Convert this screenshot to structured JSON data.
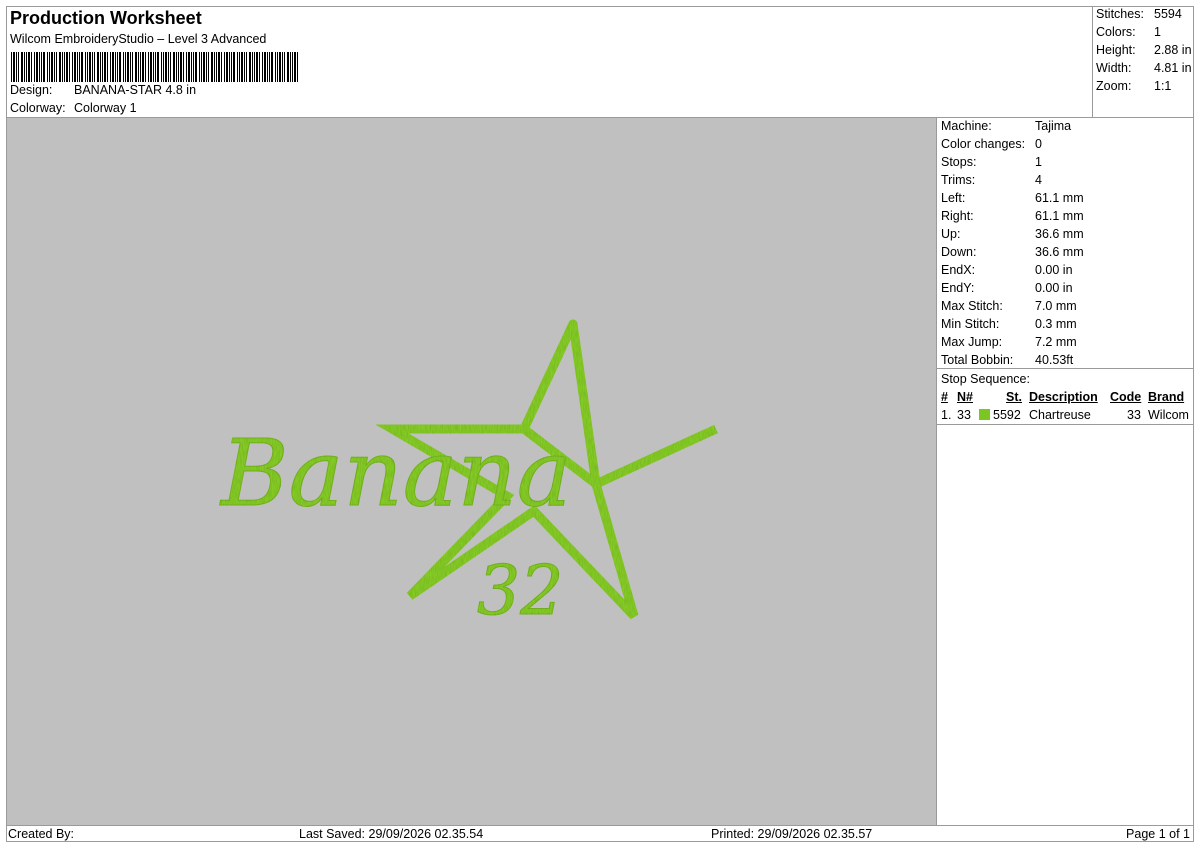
{
  "header": {
    "title": "Production Worksheet",
    "subtitle": "Wilcom EmbroideryStudio – Level 3 Advanced",
    "design_label": "Design:",
    "design_value": "BANANA-STAR 4.8 in",
    "colorway_label": "Colorway:",
    "colorway_value": "Colorway 1"
  },
  "stats": {
    "stitches_label": "Stitches:",
    "stitches": "5594",
    "colors_label": "Colors:",
    "colors": "1",
    "height_label": "Height:",
    "height": "2.88 in",
    "width_label": "Width:",
    "width": "4.81 in",
    "zoom_label": "Zoom:",
    "zoom": "1:1"
  },
  "details": [
    {
      "label": "Machine:",
      "value": "Tajima"
    },
    {
      "label": "Color changes:",
      "value": "0"
    },
    {
      "label": "Stops:",
      "value": "1"
    },
    {
      "label": "Trims:",
      "value": "4"
    },
    {
      "label": "Left:",
      "value": "61.1 mm"
    },
    {
      "label": "Right:",
      "value": "61.1 mm"
    },
    {
      "label": "Up:",
      "value": "36.6 mm"
    },
    {
      "label": "Down:",
      "value": "36.6 mm"
    },
    {
      "label": "EndX:",
      "value": "0.00 in"
    },
    {
      "label": "EndY:",
      "value": "0.00 in"
    },
    {
      "label": "Max Stitch:",
      "value": "7.0 mm"
    },
    {
      "label": "Min Stitch:",
      "value": "0.3 mm"
    },
    {
      "label": "Max Jump:",
      "value": "7.2 mm"
    },
    {
      "label": "Total Bobbin:",
      "value": "40.53ft"
    }
  ],
  "stop_sequence": {
    "title": "Stop Sequence:",
    "headers": {
      "num": "#",
      "n": "N#",
      "st": "St.",
      "description": "Description",
      "code": "Code",
      "brand": "Brand"
    },
    "rows": [
      {
        "num": "1.",
        "n": "33",
        "st": "5592",
        "description": "Chartreuse",
        "code": "33",
        "brand": "Wilcom",
        "color": "#7cc623"
      }
    ]
  },
  "design": {
    "text_main": "Banana",
    "text_number": "32",
    "thread_color": "#8cd62a",
    "background_color": "#c0c0c0"
  },
  "footer": {
    "created_by": "Created By:",
    "last_saved": "Last Saved: 29/09/2026 02.35.54",
    "printed": "Printed: 29/09/2026 02.35.57",
    "page": "Page 1 of 1"
  }
}
